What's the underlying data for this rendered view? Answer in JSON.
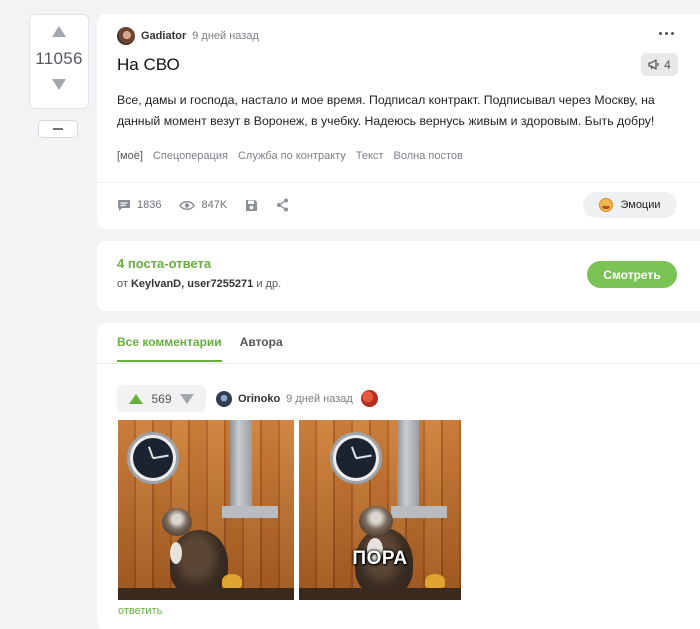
{
  "post": {
    "rating": "11056",
    "author": "Gadiator",
    "time": "9 дней назад",
    "title": "На СВО",
    "badge_count": "4",
    "text": "Все, дамы и господа, настало и мое время. Подписал контракт. Подписывал через Москву, на данный момент везут в Воронеж, в учебку. Надеюсь вернусь живым и здоровым. Быть добру!",
    "tags": [
      "[моё]",
      "Спецоперация",
      "Служба по контракту",
      "Текст",
      "Волна постов"
    ],
    "comments_count": "1836",
    "views": "847K",
    "emotions_label": "Эмоции"
  },
  "answers": {
    "title": "4 поста-ответа",
    "sub_prefix": "от",
    "sub_names": "KeylvanD, user7255271",
    "sub_suffix": "и др.",
    "watch_label": "Смотреть"
  },
  "comments": {
    "tabs": [
      "Все комментарии",
      "Автора"
    ],
    "active_tab": 0,
    "comment": {
      "rating": "569",
      "author": "Orinoko",
      "time": "9 дней назад",
      "meme_caption": "ПОРА",
      "reply_label": "ответить"
    }
  },
  "colors": {
    "accent_green": "#66b03e",
    "button_green": "#79c455",
    "background": "#f2f3f5"
  },
  "icons": [
    "arrow-up-icon",
    "arrow-down-icon",
    "minus-icon",
    "more-icon",
    "megaphone-icon",
    "comment-icon",
    "eye-icon",
    "save-icon",
    "share-icon",
    "emoji-icon"
  ]
}
